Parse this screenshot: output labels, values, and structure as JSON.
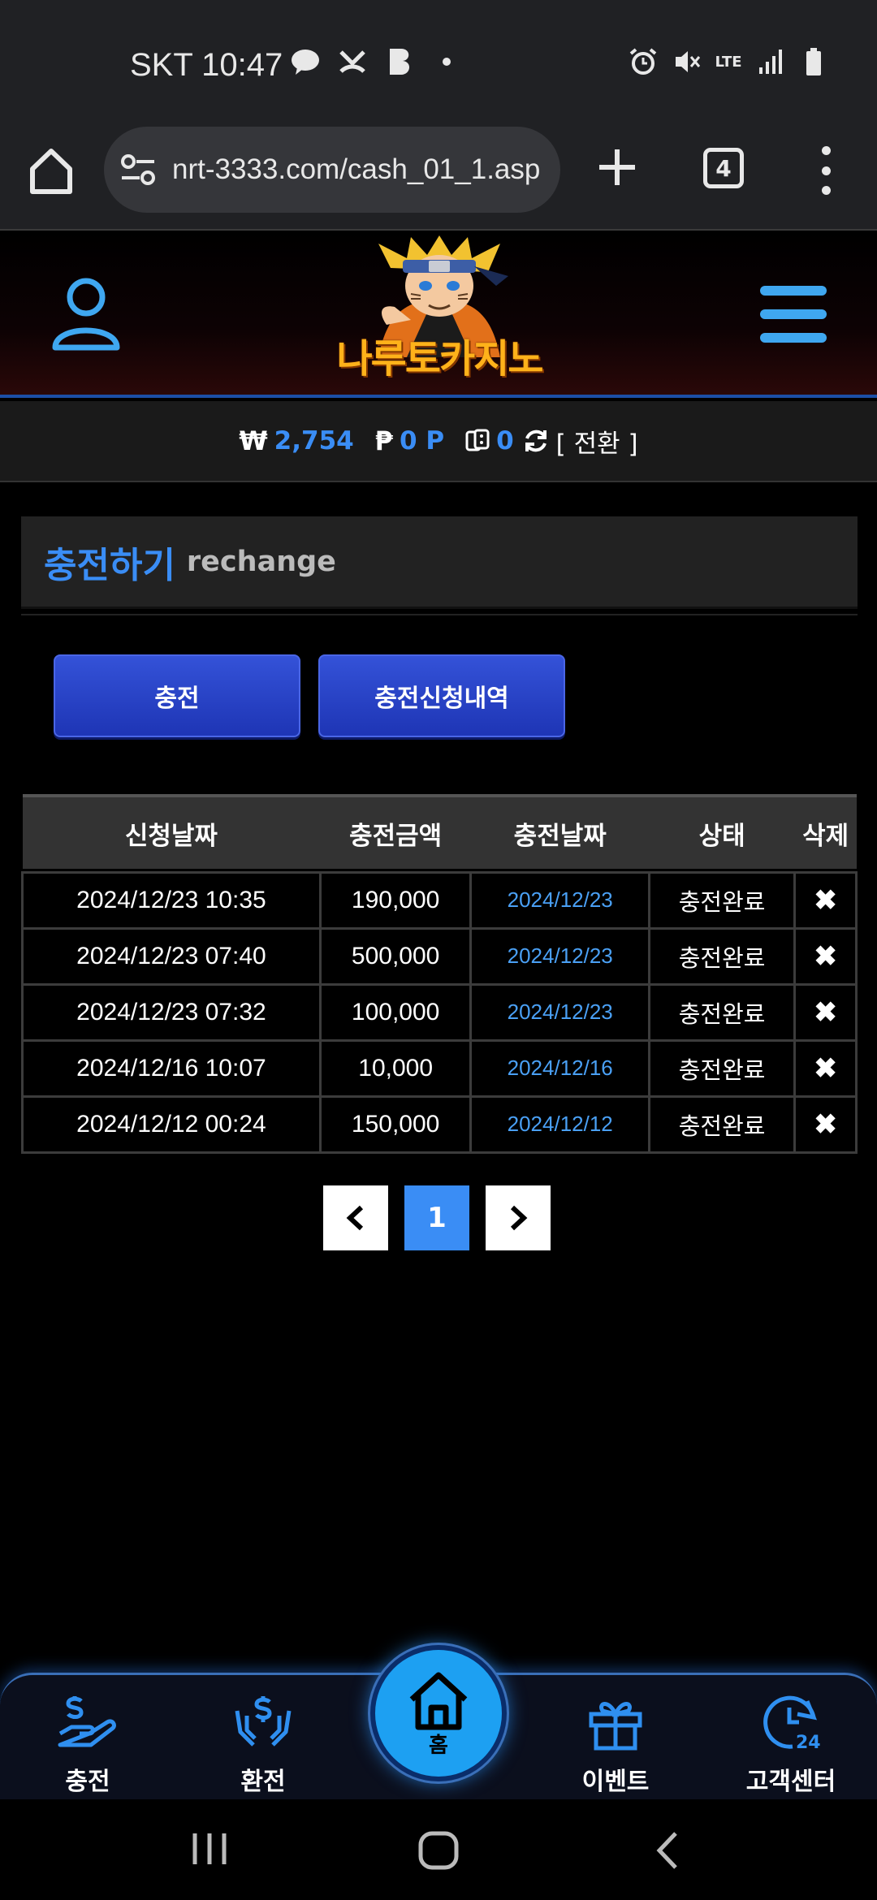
{
  "status_bar": {
    "carrier_time": "SKT 10:47",
    "network": "LTE"
  },
  "browser": {
    "url": "nrt-3333.com/cash_01_1.asp",
    "tab_count": "4"
  },
  "site": {
    "logo_text": "나루토카지노"
  },
  "balance": {
    "won_symbol": "₩",
    "won_value": "2,754",
    "point_symbol": "₱",
    "point_value": "0 P",
    "chip_value": "0",
    "toggle_label": "[ 전환 ]"
  },
  "section": {
    "title_ko": "충전하기",
    "title_en": "rechange"
  },
  "buttons": {
    "charge": "충전",
    "history": "충전신청내역"
  },
  "table": {
    "headers": [
      "신청날짜",
      "충전금액",
      "충전날짜",
      "상태",
      "삭제"
    ],
    "rows": [
      {
        "request_date": "2024/12/23 10:35",
        "amount": "190,000",
        "charge_date": "2024/12/23",
        "status": "충전완료",
        "delete": "✖"
      },
      {
        "request_date": "2024/12/23 07:40",
        "amount": "500,000",
        "charge_date": "2024/12/23",
        "status": "충전완료",
        "delete": "✖"
      },
      {
        "request_date": "2024/12/23 07:32",
        "amount": "100,000",
        "charge_date": "2024/12/23",
        "status": "충전완료",
        "delete": "✖"
      },
      {
        "request_date": "2024/12/16 10:07",
        "amount": "10,000",
        "charge_date": "2024/12/16",
        "status": "충전완료",
        "delete": "✖"
      },
      {
        "request_date": "2024/12/12 00:24",
        "amount": "150,000",
        "charge_date": "2024/12/12",
        "status": "충전완료",
        "delete": "✖"
      }
    ]
  },
  "pagination": {
    "current": "1",
    "prev": "‹",
    "next": "›"
  },
  "bottom_nav": {
    "charge": "충전",
    "exchange": "환전",
    "home": "홈",
    "event": "이벤트",
    "support": "고객센터"
  },
  "colors": {
    "accent_blue": "#3a8df5",
    "nav_home": "#1da0f2",
    "button_blue": "#2a44c8"
  }
}
